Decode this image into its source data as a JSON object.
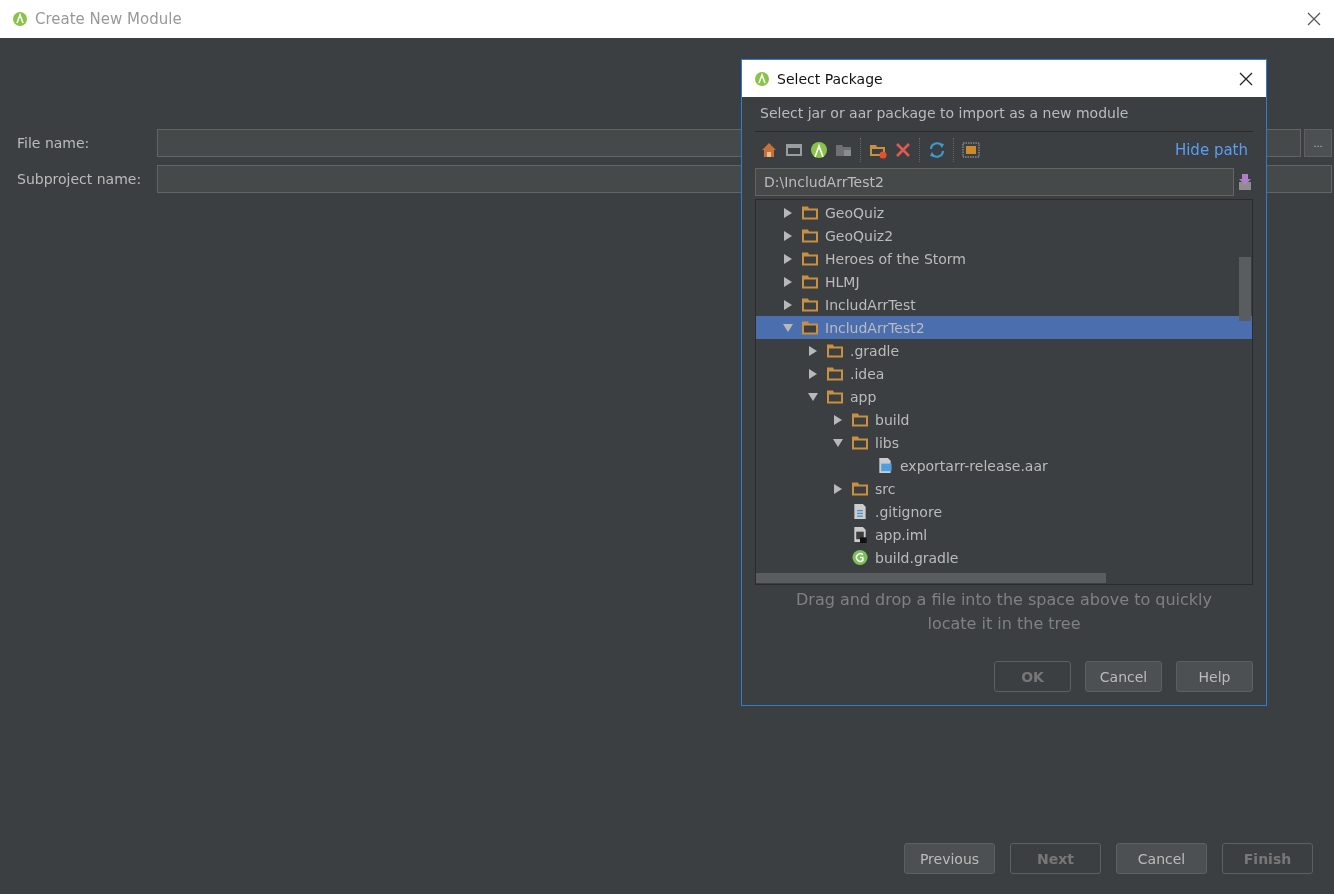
{
  "window": {
    "title": "Create New Module"
  },
  "form": {
    "fields": [
      {
        "label": "File name:",
        "browse_button": "..."
      },
      {
        "label": "Subproject name:"
      }
    ]
  },
  "footer_buttons": [
    {
      "label": "Previous",
      "disabled": false
    },
    {
      "label": "Next",
      "disabled": true
    },
    {
      "label": "Cancel",
      "disabled": false
    },
    {
      "label": "Finish",
      "disabled": true
    }
  ],
  "dialog": {
    "title": "Select Package",
    "description": "Select jar or aar package to import as a new module",
    "hide_path_link": "Hide path",
    "path": "D:\\IncludArrTest2",
    "tree": [
      {
        "name": "GeoQuiz",
        "kind": "folder",
        "expanded": false,
        "selected": false
      },
      {
        "name": "GeoQuiz2",
        "kind": "folder",
        "expanded": false,
        "selected": false
      },
      {
        "name": "Heroes of the Storm",
        "kind": "folder",
        "expanded": false,
        "selected": false
      },
      {
        "name": "HLMJ",
        "kind": "folder",
        "expanded": false,
        "selected": false
      },
      {
        "name": "IncludArrTest",
        "kind": "folder",
        "expanded": false,
        "selected": false
      },
      {
        "name": "IncludArrTest2",
        "kind": "folder",
        "expanded": true,
        "selected": true,
        "children": [
          {
            "name": ".gradle",
            "kind": "folder",
            "expanded": false,
            "selected": false
          },
          {
            "name": ".idea",
            "kind": "folder",
            "expanded": false,
            "selected": false
          },
          {
            "name": "app",
            "kind": "folder",
            "expanded": true,
            "selected": false,
            "children": [
              {
                "name": "build",
                "kind": "folder",
                "expanded": false,
                "selected": false
              },
              {
                "name": "libs",
                "kind": "folder",
                "expanded": true,
                "selected": false,
                "children": [
                  {
                    "name": "exportarr-release.aar",
                    "kind": "archive",
                    "selected": false
                  }
                ]
              },
              {
                "name": "src",
                "kind": "folder",
                "expanded": false,
                "selected": false
              },
              {
                "name": ".gitignore",
                "kind": "text",
                "selected": false
              },
              {
                "name": "app.iml",
                "kind": "module",
                "selected": false
              },
              {
                "name": "build.gradle",
                "kind": "gradle",
                "selected": false
              }
            ]
          }
        ]
      }
    ],
    "hint": "Drag and drop a file into the space above to quickly locate it in the tree",
    "buttons": [
      {
        "label": "OK",
        "disabled": true
      },
      {
        "label": "Cancel",
        "disabled": false
      },
      {
        "label": "Help",
        "disabled": false
      }
    ]
  }
}
